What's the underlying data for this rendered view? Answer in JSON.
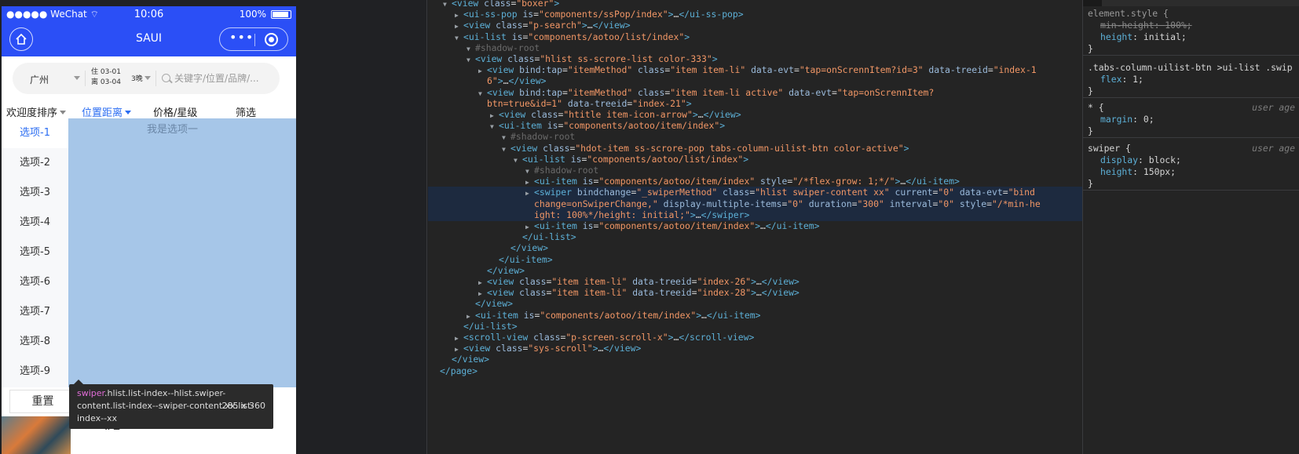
{
  "phone": {
    "status": {
      "carrier": "●●●●● WeChat ⌔",
      "time": "10:06",
      "battery_pct": "100%"
    },
    "nav": {
      "title": "SAUI",
      "capsule_dots": "•••"
    },
    "search": {
      "city": "广州",
      "checkin": "住 03-01",
      "checkout": "离 03-04",
      "nights": "3晚",
      "placeholder": "关键字/位置/品牌/..."
    },
    "filters": [
      {
        "label": "欢迎度排序",
        "caret": true,
        "active": false
      },
      {
        "label": "位置距离",
        "caret": true,
        "active": true
      },
      {
        "label": "价格/星级",
        "caret": false,
        "active": false
      },
      {
        "label": "筛选",
        "caret": false,
        "active": false
      }
    ],
    "options": [
      "选项-1",
      "选项-2",
      "选项-3",
      "选项-4",
      "选项-5",
      "选项-6",
      "选项-7",
      "选项-8",
      "选项-9"
    ],
    "active_option": 0,
    "slide_text": "我是选项一",
    "reset_label": "重置",
    "thumb_caption": "#2",
    "tooltip": {
      "tag": "swiper",
      "text": ".hlist.list-index--hlist.swiper-content.list-index--swiper-content.xx.list-index--xx",
      "size": "285 x 360"
    }
  },
  "elements": {
    "lines": [
      {
        "d": 0,
        "tw": "▼",
        "h": [
          [
            "tg",
            "<view "
          ],
          [
            "an",
            "class"
          ],
          [
            "tx",
            "="
          ],
          [
            "av",
            "\"boxer\""
          ],
          [
            "tg",
            ">"
          ]
        ]
      },
      {
        "d": 1,
        "tw": "▶",
        "h": [
          [
            "tg",
            "<ui-ss-pop "
          ],
          [
            "an",
            "is"
          ],
          [
            "tx",
            "="
          ],
          [
            "av",
            "\"components/ssPop/index\""
          ],
          [
            "tg",
            ">"
          ],
          [
            "tx",
            "…"
          ],
          [
            "tg",
            "</ui-ss-pop>"
          ]
        ]
      },
      {
        "d": 1,
        "tw": "▶",
        "h": [
          [
            "tg",
            "<view "
          ],
          [
            "an",
            "class"
          ],
          [
            "tx",
            "="
          ],
          [
            "av",
            "\"p-search\""
          ],
          [
            "tg",
            ">"
          ],
          [
            "tx",
            "…"
          ],
          [
            "tg",
            "</view>"
          ]
        ]
      },
      {
        "d": 1,
        "tw": "▼",
        "h": [
          [
            "tg",
            "<ui-list "
          ],
          [
            "an",
            "is"
          ],
          [
            "tx",
            "="
          ],
          [
            "av",
            "\"components/aotoo/list/index\""
          ],
          [
            "tg",
            ">"
          ]
        ]
      },
      {
        "d": 2,
        "tw": "▼",
        "h": [
          [
            "sr",
            "#shadow-root"
          ]
        ]
      },
      {
        "d": 2,
        "tw": "▼",
        "h": [
          [
            "tg",
            "<view "
          ],
          [
            "an",
            "class"
          ],
          [
            "tx",
            "="
          ],
          [
            "av",
            "\"hlist ss-scrore-list color-333\""
          ],
          [
            "tg",
            ">"
          ]
        ]
      },
      {
        "d": 3,
        "tw": "▶",
        "h": [
          [
            "tg",
            "<view "
          ],
          [
            "an",
            "bind:tap"
          ],
          [
            "tx",
            "="
          ],
          [
            "av",
            "\"itemMethod\""
          ],
          [
            "tx",
            " "
          ],
          [
            "an",
            "class"
          ],
          [
            "tx",
            "="
          ],
          [
            "av",
            "\"item item-li\""
          ],
          [
            "tx",
            " "
          ],
          [
            "an",
            "data-evt"
          ],
          [
            "tx",
            "="
          ],
          [
            "av",
            "\"tap=onScrennItem?id=3\""
          ],
          [
            "tx",
            " "
          ],
          [
            "an",
            "data-treeid"
          ],
          [
            "tx",
            "="
          ],
          [
            "av",
            "\"index-1"
          ]
        ]
      },
      {
        "d": 3,
        "tw": "",
        "h": [
          [
            "av",
            "6\""
          ],
          [
            "tg",
            ">"
          ],
          [
            "tx",
            "…"
          ],
          [
            "tg",
            "</view>"
          ]
        ]
      },
      {
        "d": 3,
        "tw": "▼",
        "h": [
          [
            "tg",
            "<view "
          ],
          [
            "an",
            "bind:tap"
          ],
          [
            "tx",
            "="
          ],
          [
            "av",
            "\"itemMethod\""
          ],
          [
            "tx",
            " "
          ],
          [
            "an",
            "class"
          ],
          [
            "tx",
            "="
          ],
          [
            "av",
            "\"item item-li active\""
          ],
          [
            "tx",
            " "
          ],
          [
            "an",
            "data-evt"
          ],
          [
            "tx",
            "="
          ],
          [
            "av",
            "\"tap=onScrennItem?"
          ]
        ]
      },
      {
        "d": 3,
        "tw": "",
        "h": [
          [
            "av",
            "btn=true&id=1\""
          ],
          [
            "tx",
            " "
          ],
          [
            "an",
            "data-treeid"
          ],
          [
            "tx",
            "="
          ],
          [
            "av",
            "\"index-21\""
          ],
          [
            "tg",
            ">"
          ]
        ]
      },
      {
        "d": 4,
        "tw": "▶",
        "h": [
          [
            "tg",
            "<view "
          ],
          [
            "an",
            "class"
          ],
          [
            "tx",
            "="
          ],
          [
            "av",
            "\"htitle item-icon-arrow\""
          ],
          [
            "tg",
            ">"
          ],
          [
            "tx",
            "…"
          ],
          [
            "tg",
            "</view>"
          ]
        ]
      },
      {
        "d": 4,
        "tw": "▼",
        "h": [
          [
            "tg",
            "<ui-item "
          ],
          [
            "an",
            "is"
          ],
          [
            "tx",
            "="
          ],
          [
            "av",
            "\"components/aotoo/item/index\""
          ],
          [
            "tg",
            ">"
          ]
        ]
      },
      {
        "d": 5,
        "tw": "▼",
        "h": [
          [
            "sr",
            "#shadow-root"
          ]
        ]
      },
      {
        "d": 5,
        "tw": "▼",
        "h": [
          [
            "tg",
            "<view "
          ],
          [
            "an",
            "class"
          ],
          [
            "tx",
            "="
          ],
          [
            "av",
            "\"hdot-item ss-scrore-pop tabs-column-uilist-btn color-active\""
          ],
          [
            "tg",
            ">"
          ]
        ]
      },
      {
        "d": 6,
        "tw": "▼",
        "h": [
          [
            "tg",
            "<ui-list "
          ],
          [
            "an",
            "is"
          ],
          [
            "tx",
            "="
          ],
          [
            "av",
            "\"components/aotoo/list/index\""
          ],
          [
            "tg",
            ">"
          ]
        ]
      },
      {
        "d": 7,
        "tw": "▼",
        "h": [
          [
            "sr",
            "#shadow-root"
          ]
        ]
      },
      {
        "d": 7,
        "tw": "▶",
        "h": [
          [
            "tg",
            "<ui-item "
          ],
          [
            "an",
            "is"
          ],
          [
            "tx",
            "="
          ],
          [
            "av",
            "\"components/aotoo/item/index\""
          ],
          [
            "tx",
            " "
          ],
          [
            "an",
            "style"
          ],
          [
            "tx",
            "="
          ],
          [
            "av",
            "\"/*flex-grow: 1;*/\""
          ],
          [
            "tg",
            ">"
          ],
          [
            "tx",
            "…"
          ],
          [
            "tg",
            "</ui-item>"
          ]
        ]
      },
      {
        "d": 7,
        "tw": "▶",
        "sel": true,
        "h": [
          [
            "tg",
            "<swiper "
          ],
          [
            "an",
            "bindchange"
          ],
          [
            "tx",
            "="
          ],
          [
            "av",
            "\"_swiperMethod\""
          ],
          [
            "tx",
            " "
          ],
          [
            "an",
            "class"
          ],
          [
            "tx",
            "="
          ],
          [
            "av",
            "\"hlist swiper-content xx\""
          ],
          [
            "tx",
            " "
          ],
          [
            "an",
            "current"
          ],
          [
            "tx",
            "="
          ],
          [
            "av",
            "\"0\""
          ],
          [
            "tx",
            " "
          ],
          [
            "an",
            "data-evt"
          ],
          [
            "tx",
            "="
          ],
          [
            "av",
            "\"bind"
          ]
        ]
      },
      {
        "d": 7,
        "tw": "",
        "sel": true,
        "h": [
          [
            "av",
            "change=onSwiperChange,\""
          ],
          [
            "tx",
            " "
          ],
          [
            "an",
            "display-multiple-items"
          ],
          [
            "tx",
            "="
          ],
          [
            "av",
            "\"0\""
          ],
          [
            "tx",
            " "
          ],
          [
            "an",
            "duration"
          ],
          [
            "tx",
            "="
          ],
          [
            "av",
            "\"300\""
          ],
          [
            "tx",
            " "
          ],
          [
            "an",
            "interval"
          ],
          [
            "tx",
            "="
          ],
          [
            "av",
            "\"0\""
          ],
          [
            "tx",
            " "
          ],
          [
            "an",
            "style"
          ],
          [
            "tx",
            "="
          ],
          [
            "av",
            "\"/*min-he"
          ]
        ]
      },
      {
        "d": 7,
        "tw": "",
        "sel": true,
        "h": [
          [
            "av",
            "ight: 100%*/height: initial;\""
          ],
          [
            "tg",
            ">"
          ],
          [
            "tx",
            "…"
          ],
          [
            "tg",
            "</swiper>"
          ]
        ]
      },
      {
        "d": 7,
        "tw": "▶",
        "h": [
          [
            "tg",
            "<ui-item "
          ],
          [
            "an",
            "is"
          ],
          [
            "tx",
            "="
          ],
          [
            "av",
            "\"components/aotoo/item/index\""
          ],
          [
            "tg",
            ">"
          ],
          [
            "tx",
            "…"
          ],
          [
            "tg",
            "</ui-item>"
          ]
        ]
      },
      {
        "d": 6,
        "tw": "",
        "h": [
          [
            "tg",
            "</ui-list>"
          ]
        ]
      },
      {
        "d": 5,
        "tw": "",
        "h": [
          [
            "tg",
            "</view>"
          ]
        ]
      },
      {
        "d": 4,
        "tw": "",
        "h": [
          [
            "tg",
            "</ui-item>"
          ]
        ]
      },
      {
        "d": 3,
        "tw": "",
        "h": [
          [
            "tg",
            "</view>"
          ]
        ]
      },
      {
        "d": 3,
        "tw": "▶",
        "h": [
          [
            "tg",
            "<view "
          ],
          [
            "an",
            "class"
          ],
          [
            "tx",
            "="
          ],
          [
            "av",
            "\"item item-li\""
          ],
          [
            "tx",
            " "
          ],
          [
            "an",
            "data-treeid"
          ],
          [
            "tx",
            "="
          ],
          [
            "av",
            "\"index-26\""
          ],
          [
            "tg",
            ">"
          ],
          [
            "tx",
            "…"
          ],
          [
            "tg",
            "</view>"
          ]
        ]
      },
      {
        "d": 3,
        "tw": "▶",
        "h": [
          [
            "tg",
            "<view "
          ],
          [
            "an",
            "class"
          ],
          [
            "tx",
            "="
          ],
          [
            "av",
            "\"item item-li\""
          ],
          [
            "tx",
            " "
          ],
          [
            "an",
            "data-treeid"
          ],
          [
            "tx",
            "="
          ],
          [
            "av",
            "\"index-28\""
          ],
          [
            "tg",
            ">"
          ],
          [
            "tx",
            "…"
          ],
          [
            "tg",
            "</view>"
          ]
        ]
      },
      {
        "d": 2,
        "tw": "",
        "h": [
          [
            "tg",
            "</view>"
          ]
        ]
      },
      {
        "d": 2,
        "tw": "▶",
        "h": [
          [
            "tg",
            "<ui-item "
          ],
          [
            "an",
            "is"
          ],
          [
            "tx",
            "="
          ],
          [
            "av",
            "\"components/aotoo/item/index\""
          ],
          [
            "tg",
            ">"
          ],
          [
            "tx",
            "…"
          ],
          [
            "tg",
            "</ui-item>"
          ]
        ]
      },
      {
        "d": 1,
        "tw": "",
        "h": [
          [
            "tg",
            "</ui-list>"
          ]
        ]
      },
      {
        "d": 1,
        "tw": "▶",
        "h": [
          [
            "tg",
            "<scroll-view "
          ],
          [
            "an",
            "class"
          ],
          [
            "tx",
            "="
          ],
          [
            "av",
            "\"p-screen-scroll-x\""
          ],
          [
            "tg",
            ">"
          ],
          [
            "tx",
            "…"
          ],
          [
            "tg",
            "</scroll-view>"
          ]
        ]
      },
      {
        "d": 1,
        "tw": "▶",
        "h": [
          [
            "tg",
            "<view "
          ],
          [
            "an",
            "class"
          ],
          [
            "tx",
            "="
          ],
          [
            "av",
            "\"sys-scroll\""
          ],
          [
            "tg",
            ">"
          ],
          [
            "tx",
            "…"
          ],
          [
            "tg",
            "</view>"
          ]
        ]
      },
      {
        "d": 0,
        "tw": "",
        "h": [
          [
            "tg",
            "</view>"
          ]
        ]
      },
      {
        "d": -1,
        "tw": "",
        "h": [
          [
            "tg",
            "</page>"
          ]
        ]
      }
    ]
  },
  "styles": {
    "rules": [
      {
        "selector": "element.style {",
        "dim": true,
        "source": "",
        "decls": [
          {
            "name": "min-height",
            "value": "100%;",
            "strike": true
          },
          {
            "name": "height",
            "value": "initial;",
            "strike": false
          }
        ]
      },
      {
        "selector": ".tabs-column-uilist-btn >ui-list .swip",
        "dim": false,
        "source": "",
        "decls": [
          {
            "name": "flex",
            "value": "1;",
            "strike": false
          }
        ]
      },
      {
        "selector": "* {",
        "dim": false,
        "source": "user age",
        "decls": [
          {
            "name": "margin",
            "value": "0;",
            "strike": false
          }
        ]
      },
      {
        "selector": "swiper {",
        "dim": false,
        "source": "user age",
        "decls": [
          {
            "name": "display",
            "value": "block;",
            "strike": false
          },
          {
            "name": "height",
            "value": "150px;",
            "strike": false
          }
        ]
      }
    ]
  }
}
